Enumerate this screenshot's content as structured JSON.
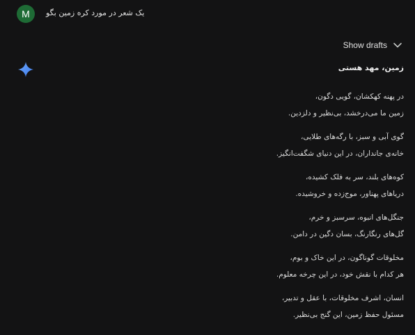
{
  "user": {
    "avatar_letter": "M",
    "prompt": "یک شعر در مورد کره زمین بگو"
  },
  "drafts": {
    "label": "Show drafts",
    "icon": "chevron-down-icon"
  },
  "assistant": {
    "icon": "sparkle-icon",
    "icon_color": "#4b8ef0",
    "title": "زمین، مهد هستی",
    "stanzas": [
      [
        "در پهنه کهکشان، گویی دگون،",
        "زمین ما می‌درخشد، بی‌نظیر و دلزدین."
      ],
      [
        "گوی آبی و سبز، با رگه‌های طلایی،",
        "خانه‌ی جانداران، در این دنیای شگفت‌انگیز."
      ],
      [
        "کوه‌های بلند، سر به فلک کشیده،",
        "دریاهای پهناور، موج‌زده و خروشیده."
      ],
      [
        "جنگل‌های انبوه، سرسبز و خرم،",
        "گل‌های رنگارنگ، بسان دگین در دامن."
      ],
      [
        "مخلوقات گوناگون، در این خاک و بوم،",
        "هر کدام با نقش خود، در این چرخه معلوم."
      ],
      [
        "انسان، اشرف مخلوقات، با عقل و تدبیر،",
        "مسئول حفظ زمین، این گنج بی‌نظیر."
      ]
    ]
  }
}
